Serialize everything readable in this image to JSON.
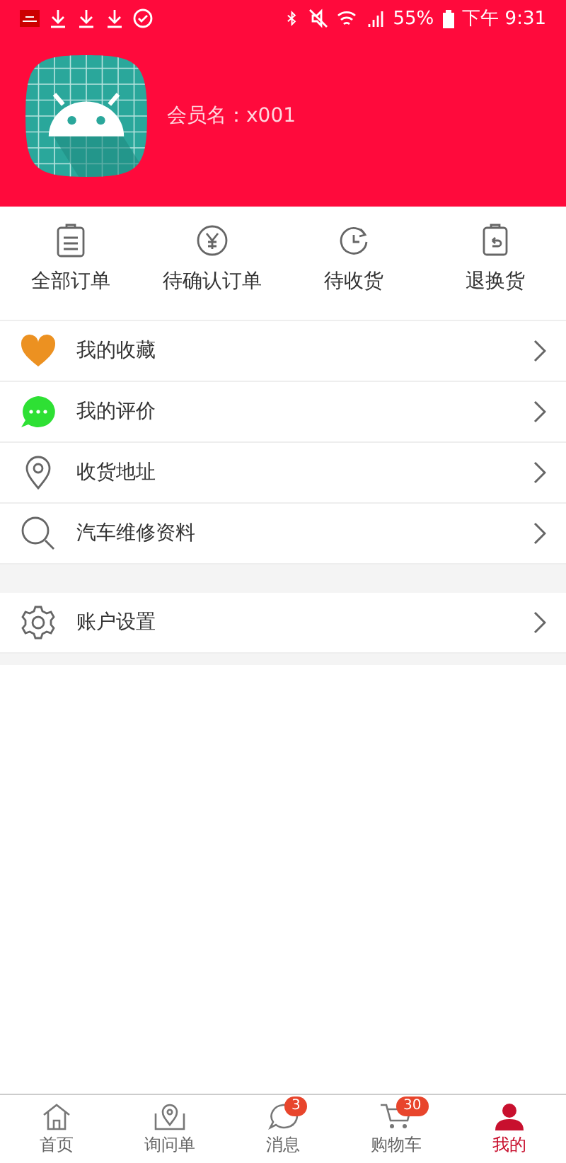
{
  "status_bar": {
    "battery": "55%",
    "time": "下午 9:31"
  },
  "profile": {
    "member_label": "会员名：x001"
  },
  "orders": [
    {
      "kind": "list",
      "label": "全部订单"
    },
    {
      "kind": "yen",
      "label": "待确认订单"
    },
    {
      "kind": "clock",
      "label": "待收货"
    },
    {
      "kind": "return",
      "label": "退换货"
    }
  ],
  "menu": [
    {
      "kind": "heart",
      "label": "我的收藏"
    },
    {
      "kind": "chat",
      "label": "我的评价"
    },
    {
      "kind": "pin",
      "label": "收货地址"
    },
    {
      "kind": "search",
      "label": "汽车维修资料"
    }
  ],
  "settings": [
    {
      "kind": "gear",
      "label": "账户设置"
    }
  ],
  "tabbar": [
    {
      "kind": "home",
      "label": "首页",
      "selected": false
    },
    {
      "kind": "pin",
      "label": "询问单",
      "selected": false
    },
    {
      "kind": "chat",
      "label": "消息",
      "selected": false,
      "badge": "3"
    },
    {
      "kind": "cart",
      "label": "购物车",
      "selected": false,
      "badge": "30"
    },
    {
      "kind": "person",
      "label": "我的",
      "selected": true
    }
  ]
}
